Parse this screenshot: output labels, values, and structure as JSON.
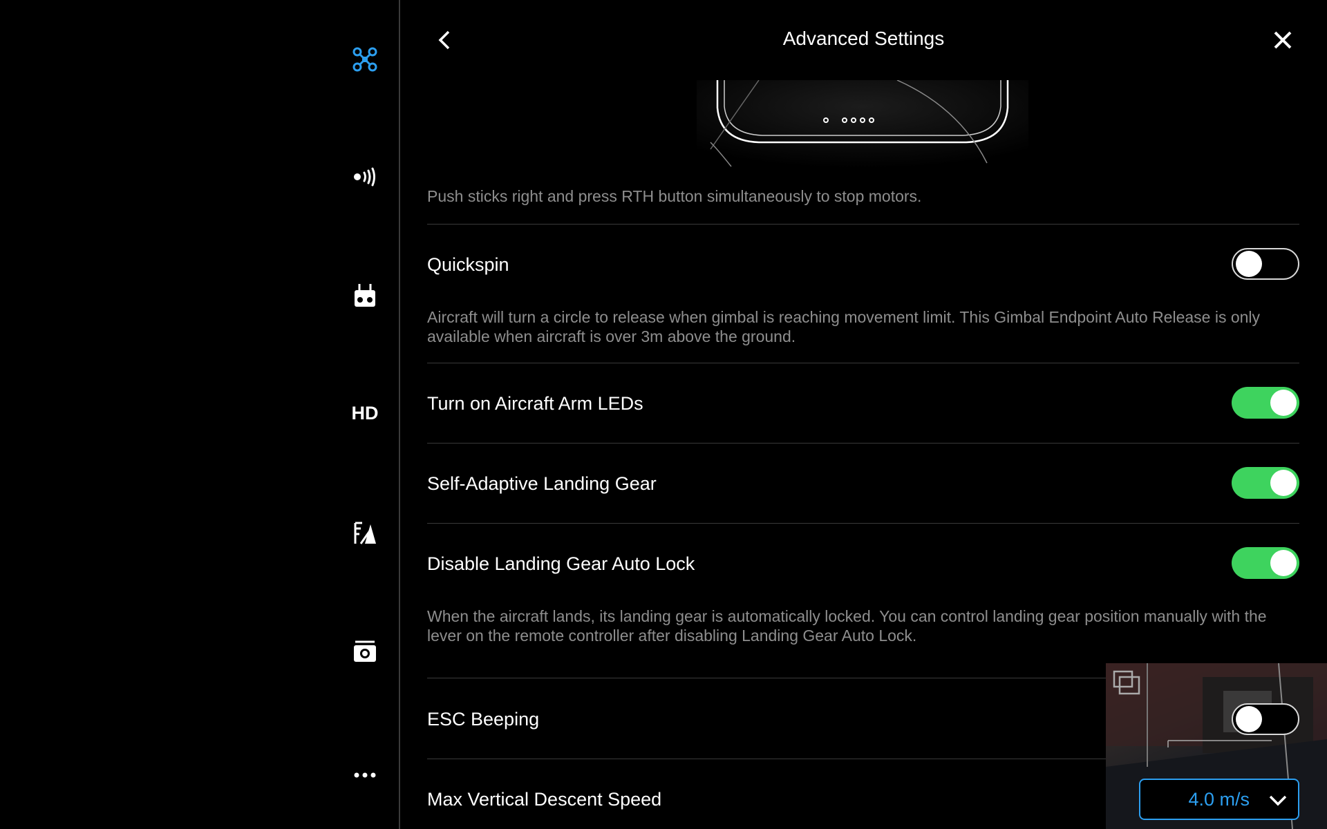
{
  "header": {
    "title": "Advanced Settings"
  },
  "sidebar": {
    "items": [
      {
        "icon": "aircraft-icon",
        "active": true
      },
      {
        "icon": "signal-icon"
      },
      {
        "icon": "remote-controller-icon"
      },
      {
        "icon": "hd-transmission-icon",
        "label": "HD"
      },
      {
        "icon": "battery-icon"
      },
      {
        "icon": "camera-icon"
      },
      {
        "icon": "more-icon"
      }
    ]
  },
  "settings": {
    "stop_motors_hint": "Push sticks right and press RTH button simultaneously to stop motors.",
    "quickspin": {
      "label": "Quickspin",
      "enabled": false,
      "hint": "Aircraft will turn a circle to release when gimbal is reaching movement limit. This Gimbal Endpoint Auto Release is only available when aircraft is over 3m above the ground."
    },
    "arm_leds": {
      "label": "Turn on Aircraft Arm LEDs",
      "enabled": true
    },
    "landing_gear": {
      "label": "Self-Adaptive Landing Gear",
      "enabled": true
    },
    "gear_auto_lock": {
      "label": "Disable Landing Gear Auto Lock",
      "enabled": true,
      "hint": "When the aircraft lands, its landing gear is automatically locked. You can control landing gear position manually with the lever on the remote controller after disabling Landing Gear Auto Lock."
    },
    "esc_beeping": {
      "label": "ESC Beeping",
      "enabled": false
    },
    "descent_speed": {
      "label": "Max Vertical Descent Speed",
      "value": "4.0 m/s"
    }
  },
  "colors": {
    "accent": "#2c9ff0",
    "toggle_on": "#3ed35e",
    "hint_text": "#8e8e8e",
    "divider": "#3a3a3a"
  }
}
